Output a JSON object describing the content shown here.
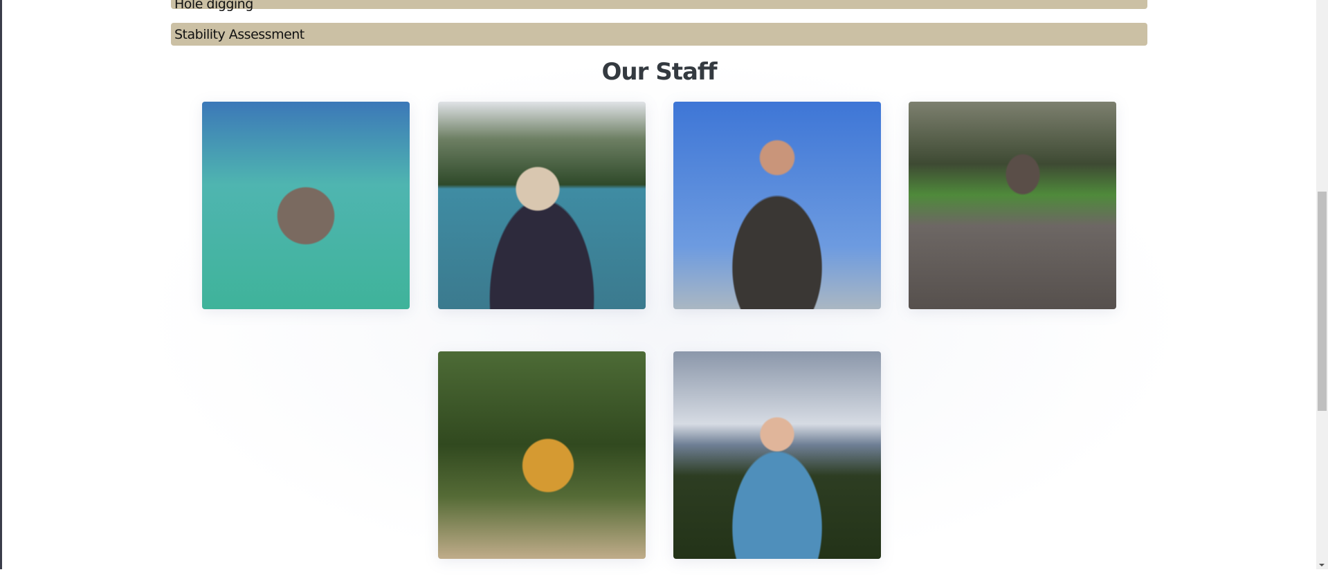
{
  "services": [
    "Hole digging",
    "Stability Assessment"
  ],
  "staff_heading": "Our Staff",
  "staff_photos": [
    {
      "icon": "staff-photo-snorkeler"
    },
    {
      "icon": "staff-photo-man-sunglasses"
    },
    {
      "icon": "staff-photo-young-man-sweatshirt"
    },
    {
      "icon": "staff-photo-skateboarder"
    },
    {
      "icon": "staff-photo-woman-hi-vis-vest"
    },
    {
      "icon": "staff-photo-young-man-hoodie"
    }
  ],
  "scrollbar": {
    "position_fraction": 0.55
  },
  "colors": {
    "service_bar": "#cbc0a4",
    "heading": "#343a40"
  }
}
